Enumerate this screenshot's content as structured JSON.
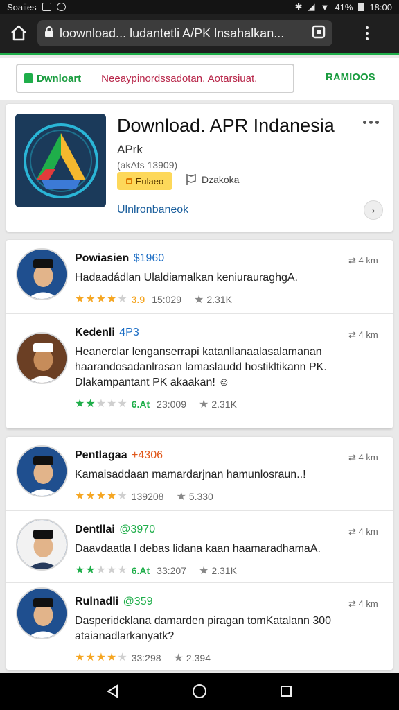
{
  "status_bar": {
    "carrier": "Soaiies",
    "battery": "41%",
    "time": "18:00"
  },
  "browser": {
    "url": "loownload... ludantetli A/PK lnsahalkan...",
    "home_icon": "home-icon",
    "lock_icon": "lock-icon",
    "tabs_icon": "tabs-icon",
    "menu_icon": "more-vert-icon"
  },
  "banner": {
    "download_label": "Dwnloart",
    "message": "Neeaypinordssadotan. Aotarsiuat.",
    "right_label": "RAMIOOS"
  },
  "app": {
    "title": "Download. APR Indanesia",
    "subtitle": "APrk",
    "meta": "(akAts 13909)",
    "install_label": "Eulaeo",
    "flag_label": "Dzakoka",
    "link_text": "Ulnlronbaneok",
    "colors": {
      "brand_green": "#1fae4a",
      "accent_blue": "#1a5e9c"
    }
  },
  "review_groups": [
    {
      "reviews": [
        {
          "name": "Powiasien",
          "tag": "$1960",
          "tag_color": "#1a6cc4",
          "time": "4 km",
          "text": "Hadaadádlan Ulaldiamalkan keniurauraghgA.",
          "rating_label": "3.9",
          "stars": 4,
          "star_color": "#f5a623",
          "rating_count": "15:029",
          "likes": "2.31K",
          "avatar_style": "formal"
        },
        {
          "name": "Kedenli",
          "tag": "4P3",
          "tag_color": "#1a6cc4",
          "time": "4 km",
          "text": "Heanerclar lenganserrapi katanllanaalasalamanan haarandosadanlrasan lamaslaudd hostikltikann PK. Dlakampantant PK akaakan! ☺",
          "rating_label": "6.At",
          "stars": 2,
          "star_color": "#1fae4a",
          "rating_count": "23:009",
          "likes": "2.31K",
          "avatar_style": "brown"
        }
      ]
    },
    {
      "reviews": [
        {
          "name": "Pentlagaa",
          "tag": "+4306",
          "tag_color": "#e0571a",
          "time": "4 km",
          "text": "Kamaisaddaan mamardarjnan hamunlosraun..!",
          "rating_label": "",
          "stars": 4,
          "star_color": "#f5a623",
          "rating_count": "139208",
          "likes": "5.330",
          "avatar_style": "formal"
        },
        {
          "name": "Dentllai",
          "tag": "@3970",
          "tag_color": "#1fae4a",
          "time": "4 km",
          "text": "Daavdaatla l debas lidana kaan haamaradhamaA.",
          "rating_label": "6.At",
          "stars": 2,
          "star_color": "#1fae4a",
          "rating_count": "33:207",
          "likes": "2.31K",
          "avatar_style": "light"
        },
        {
          "name": "Rulnadli",
          "tag": "@359",
          "tag_color": "#1fae4a",
          "time": "4 km",
          "text": "Dasperidcklana damarden piragan tomKatalann 300 ataianadlarkanyatk?",
          "rating_label": "",
          "stars": 4,
          "star_color": "#f5a623",
          "rating_count": "33:298",
          "likes": "2.394",
          "avatar_style": "formal"
        }
      ]
    }
  ],
  "nav": {
    "back_icon": "back-icon",
    "home_icon": "home-circle-icon",
    "recents_icon": "recents-icon"
  }
}
